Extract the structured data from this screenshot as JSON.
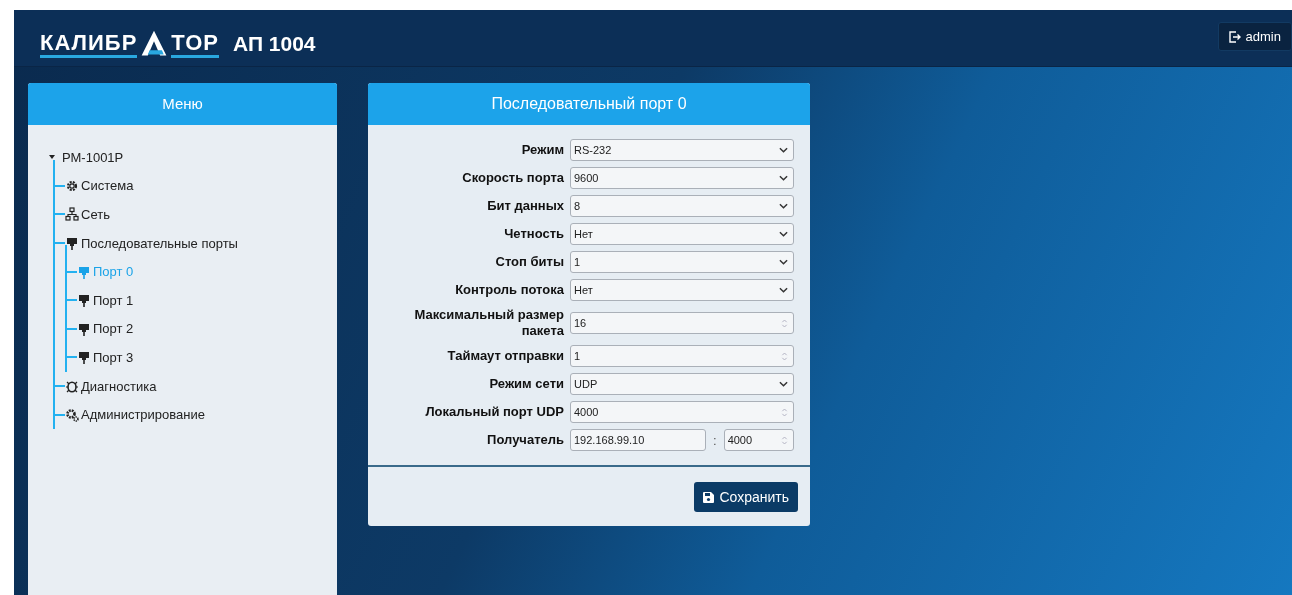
{
  "header": {
    "logo": {
      "left": "КАЛИБР",
      "right": "ТОР"
    },
    "model": "АП 1004",
    "user_button": "admin"
  },
  "menu": {
    "title": "Меню",
    "tree": [
      {
        "label": "РМ-1001Р",
        "expanded": true,
        "selected": false,
        "children": [
          {
            "label": "Система",
            "kind": "gear",
            "selected": false
          },
          {
            "label": "Сеть",
            "kind": "network",
            "selected": false
          },
          {
            "label": "Последовательные порты",
            "kind": "port",
            "selected": false,
            "children": [
              {
                "label": "Порт 0",
                "kind": "port",
                "selected": true
              },
              {
                "label": "Порт 1",
                "kind": "port",
                "selected": false
              },
              {
                "label": "Порт 2",
                "kind": "port",
                "selected": false
              },
              {
                "label": "Порт 3",
                "kind": "port",
                "selected": false
              }
            ]
          },
          {
            "label": "Диагностика",
            "kind": "bug",
            "selected": false
          },
          {
            "label": "Администрирование",
            "kind": "gears",
            "selected": false
          }
        ]
      }
    ]
  },
  "form": {
    "title": "Последовательный порт 0",
    "fields": [
      {
        "label": "Режим",
        "kind": "select",
        "value": "RS-232"
      },
      {
        "label": "Скорость порта",
        "kind": "select",
        "value": "9600"
      },
      {
        "label": "Бит данных",
        "kind": "select",
        "value": "8"
      },
      {
        "label": "Четность",
        "kind": "select",
        "value": "Нет"
      },
      {
        "label": "Стоп биты",
        "kind": "select",
        "value": "1"
      },
      {
        "label": "Контроль потока",
        "kind": "select",
        "value": "Нет"
      },
      {
        "label": "Максимальный размер пакета",
        "kind": "number",
        "value": "16"
      },
      {
        "label": "Таймаут отправки",
        "kind": "number",
        "value": "1"
      },
      {
        "label": "Режим сети",
        "kind": "select",
        "value": "UDP"
      },
      {
        "label": "Локальный порт UDP",
        "kind": "number",
        "value": "4000"
      },
      {
        "label": "Получатель",
        "kind": "address",
        "value": "192.168.99.10",
        "separator": ":",
        "port": "4000"
      }
    ],
    "save_button": "Сохранить"
  }
}
